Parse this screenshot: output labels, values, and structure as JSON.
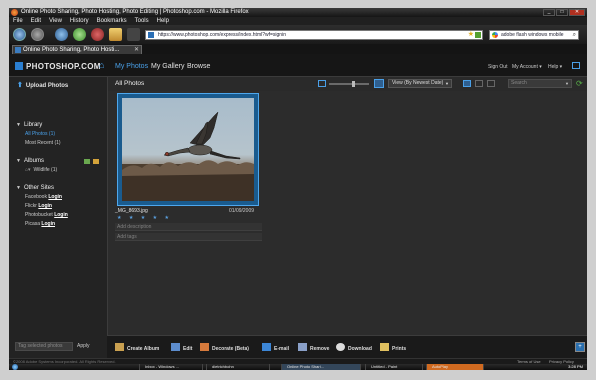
{
  "window": {
    "title": "Online Photo Sharing, Photo Hosting, Photo Editing | Photoshop.com - Mozilla Firefox",
    "controls": [
      "_",
      "□",
      "✕"
    ]
  },
  "menu": [
    "File",
    "Edit",
    "View",
    "History",
    "Bookmarks",
    "Tools",
    "Help"
  ],
  "nav": {
    "url": "https://www.photoshop.com/express/index.html?wf=signin",
    "search_text": "adobe flash windows mobile"
  },
  "tab": {
    "label": "Online Photo Sharing, Photo Hosti...",
    "close": "✕"
  },
  "app": {
    "logo": "PHOTOSHOP.COM",
    "nav_items": [
      "My Photos",
      "My Gallery",
      "Browse"
    ],
    "links": [
      "Sign Out",
      "My Account ▾",
      "Help ▾"
    ]
  },
  "sidebar": {
    "upload_label": "Upload Photos",
    "library": {
      "heading": "Library",
      "items": [
        "All Photos (1)",
        "Most Recent (1)"
      ]
    },
    "albums": {
      "heading": "Albums",
      "items": [
        "Wildlife (1)"
      ]
    },
    "other_sites": {
      "heading": "Other Sites",
      "items": [
        {
          "site": "Facebook",
          "action": "Login"
        },
        {
          "site": "Flickr",
          "action": "Login"
        },
        {
          "site": "Photobucket",
          "action": "Login"
        },
        {
          "site": "Picasa",
          "action": "Login"
        }
      ]
    },
    "tag_placeholder": "Tag selected photos",
    "apply_label": "Apply"
  },
  "content": {
    "title": "All Photos",
    "view_select": "View (By Newest Date)",
    "search_placeholder": "Search",
    "photo": {
      "filename": "_MG_8693.jpg",
      "date": "01/09/2009",
      "rating_stars": "★ ★ ★ ★ ★",
      "description_placeholder": "Add description",
      "tags_placeholder": "Add tags"
    }
  },
  "actions": [
    "Create Album",
    "Edit",
    "Decorate (Beta)",
    "E-mail",
    "Remove",
    "Download",
    "Prints"
  ],
  "footer": {
    "copyright": "©2008 Adobe Systems Incorporated. All Rights Reserved.",
    "terms": "Terms of Use",
    "privacy": "Privacy Policy"
  },
  "taskbar": {
    "items": [
      "Inbox - Windows ...",
      "dietrichbohn",
      "Online Photo Shari...",
      "Untitled - Paint",
      "AutoPlay"
    ],
    "clock": "3:28 PM"
  },
  "colors": {
    "accent": "#4aa0e8",
    "selection_border": "#4ea8ee",
    "app_background": "#2c2c2c"
  }
}
